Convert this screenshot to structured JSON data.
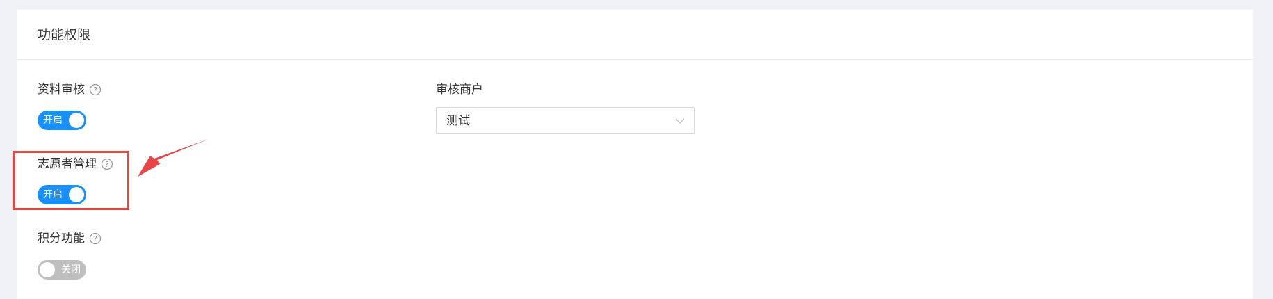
{
  "section": {
    "title": "功能权限"
  },
  "fields": {
    "review": {
      "label": "资料审核",
      "switch_label": "开启",
      "enabled": true
    },
    "merchant": {
      "label": "审核商户",
      "value": "测试"
    },
    "volunteer": {
      "label": "志愿者管理",
      "switch_label": "开启",
      "enabled": true
    },
    "points": {
      "label": "积分功能",
      "switch_label": "关闭",
      "enabled": false
    }
  },
  "icons": {
    "help": "question-circle-icon",
    "select": "chevron-down-icon",
    "annotation": "red-arrow-icon"
  },
  "colors": {
    "switch_on": "#1890ff",
    "switch_off": "#bfbfbf",
    "annotation": "#e84545"
  }
}
